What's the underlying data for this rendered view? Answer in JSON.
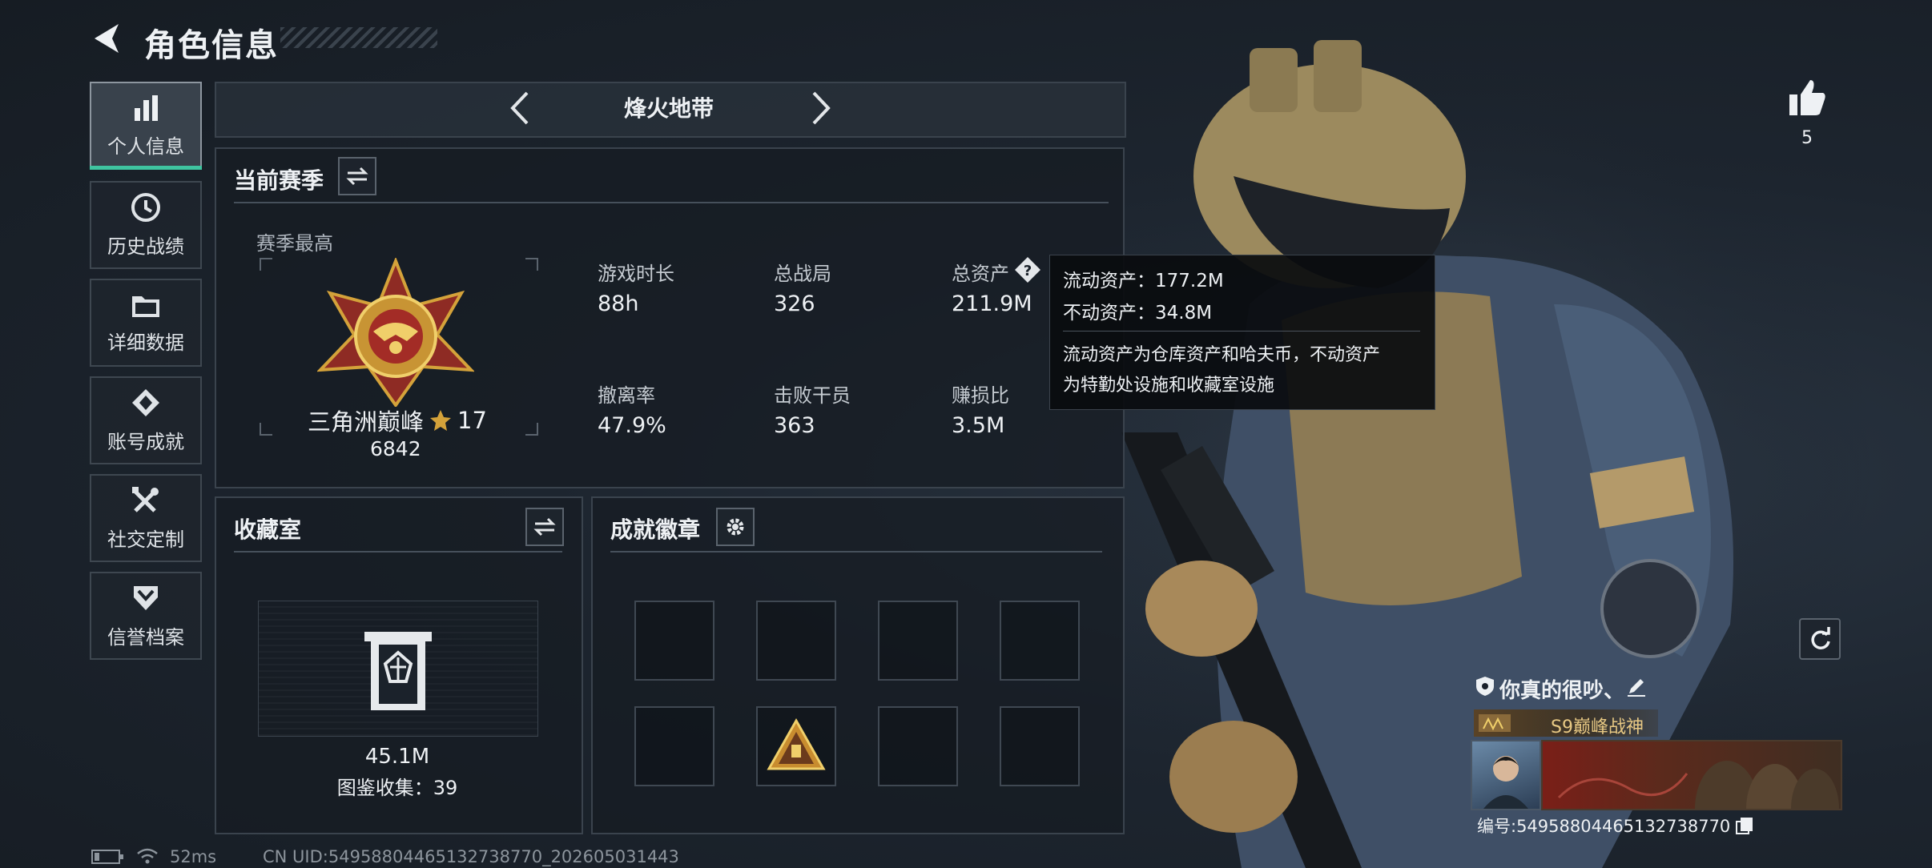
{
  "header": {
    "title": "角色信息"
  },
  "sidebar": {
    "items": [
      {
        "label": "个人信息",
        "icon": "bar-chart-icon",
        "active": true
      },
      {
        "label": "历史战绩",
        "icon": "clock-history-icon",
        "active": false
      },
      {
        "label": "详细数据",
        "icon": "folder-icon",
        "active": false
      },
      {
        "label": "账号成就",
        "icon": "achievement-icon",
        "active": false
      },
      {
        "label": "社交定制",
        "icon": "tools-icon",
        "active": false
      },
      {
        "label": "信誉档案",
        "icon": "shield-chevron-icon",
        "active": false
      }
    ]
  },
  "mode_selector": {
    "label": "烽火地带"
  },
  "season": {
    "title": "当前赛季",
    "best_label": "赛季最高",
    "rank_name": "三角洲巅峰",
    "rank_stars": "17",
    "rank_score": "6842",
    "stats": [
      {
        "label": "游戏时长",
        "value": "88h"
      },
      {
        "label": "总战局",
        "value": "326"
      },
      {
        "label": "总资产",
        "value": "211.9M"
      },
      {
        "label": "撤离率",
        "value": "47.9%"
      },
      {
        "label": "击败干员",
        "value": "363"
      },
      {
        "label": "赚损比",
        "value": "3.5M"
      }
    ]
  },
  "tooltip": {
    "liquid": "流动资产：177.2M",
    "fixed": "不动资产：34.8M",
    "desc_line1": "流动资产为仓库资产和哈夫币，不动资产",
    "desc_line2": "为特勤处设施和收藏室设施"
  },
  "collection": {
    "title": "收藏室",
    "value": "45.1M",
    "count": "图鉴收集：39"
  },
  "badges": {
    "title": "成就徽章"
  },
  "likes": {
    "count": "5"
  },
  "profile": {
    "nickname": "你真的很吵、",
    "title_tag": "S9巅峰战神",
    "id_text": "编号:5495880446513273877​0"
  },
  "status_bar": {
    "ping": "52ms",
    "uid": "CN UID:54958804465132738770_202605031443"
  },
  "colors": {
    "accent": "#3fc4a0",
    "panel_border": "#3a434d",
    "gold": "#d4a23a"
  }
}
